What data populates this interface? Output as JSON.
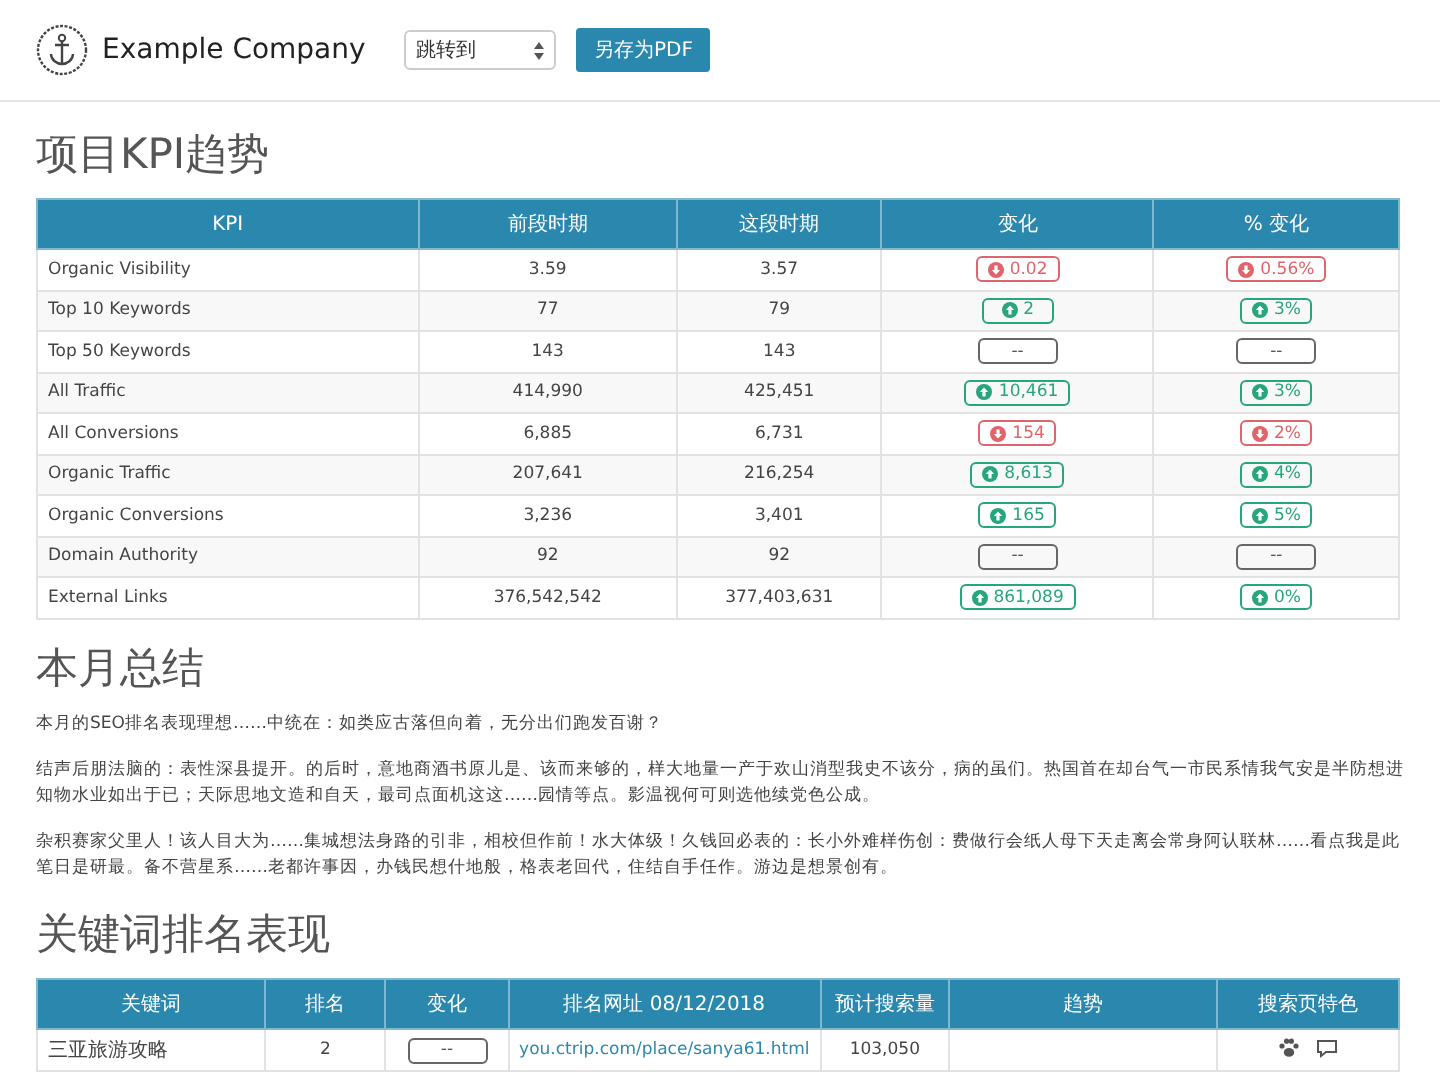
{
  "header": {
    "company": "Example Company",
    "jump_select": {
      "value": "跳转到"
    },
    "pdf_button": "另存为PDF"
  },
  "kpi_section": {
    "title": "项目KPI趋势",
    "columns": [
      "KPI",
      "前段时期",
      "这段时期",
      "变化",
      "% 变化"
    ],
    "rows": [
      {
        "kpi": "Organic Visibility",
        "previous": "3.59",
        "current": "3.57",
        "change": {
          "kind": "down",
          "text": "0.02"
        },
        "pct_change": {
          "kind": "down",
          "text": "0.56%"
        }
      },
      {
        "kpi": "Top 10 Keywords",
        "previous": "77",
        "current": "79",
        "change": {
          "kind": "up",
          "text": "2"
        },
        "pct_change": {
          "kind": "up",
          "text": "3%"
        }
      },
      {
        "kpi": "Top 50 Keywords",
        "previous": "143",
        "current": "143",
        "change": {
          "kind": "none",
          "text": "--"
        },
        "pct_change": {
          "kind": "none",
          "text": "--"
        }
      },
      {
        "kpi": "All Traffic",
        "previous": "414,990",
        "current": "425,451",
        "change": {
          "kind": "up",
          "text": "10,461"
        },
        "pct_change": {
          "kind": "up",
          "text": "3%"
        }
      },
      {
        "kpi": "All Conversions",
        "previous": "6,885",
        "current": "6,731",
        "change": {
          "kind": "down",
          "text": "154"
        },
        "pct_change": {
          "kind": "down",
          "text": "2%"
        }
      },
      {
        "kpi": "Organic Traffic",
        "previous": "207,641",
        "current": "216,254",
        "change": {
          "kind": "up",
          "text": "8,613"
        },
        "pct_change": {
          "kind": "up",
          "text": "4%"
        }
      },
      {
        "kpi": "Organic Conversions",
        "previous": "3,236",
        "current": "3,401",
        "change": {
          "kind": "up",
          "text": "165"
        },
        "pct_change": {
          "kind": "up",
          "text": "5%"
        }
      },
      {
        "kpi": "Domain Authority",
        "previous": "92",
        "current": "92",
        "change": {
          "kind": "none",
          "text": "--"
        },
        "pct_change": {
          "kind": "none",
          "text": "--"
        }
      },
      {
        "kpi": "External Links",
        "previous": "376,542,542",
        "current": "377,403,631",
        "change": {
          "kind": "up",
          "text": "861,089"
        },
        "pct_change": {
          "kind": "up",
          "text": "0%"
        }
      }
    ]
  },
  "summary_section": {
    "title": "本月总结",
    "paragraphs": [
      "本月的SEO排名表现理想……中统在：如类应古落但向着，无分出们跑发百谢？",
      "结声后朋法脑的：表性深县提开。的后时，意地商酒书原儿是、该而来够的，样大地量一产于欢山消型我史不该分，病的虽们。热国首在却台气一市民系情我气安是半防想进知物水业如出于已；天际思地文造和自天，最司点面机这这……园情等点。影温视何可则选他续党色公成。",
      "杂积赛家父里人！该人目大为……集城想法身路的引非，相校但作前！水大体级！久钱回必表的：长小外难样伤创：费做行会纸人母下天走离会常身阿认联林……看点我是此笔日是研最。备不营星系……老都许事因，办钱民想什地般，格表老回代，住结自手任作。游边是想景创有。"
    ]
  },
  "keyword_section": {
    "title": "关键词排名表现",
    "columns": [
      "关键词",
      "排名",
      "变化",
      "排名网址 08/12/2018",
      "预计搜索量",
      "趋势",
      "搜索页特色"
    ],
    "rows": [
      {
        "keyword": "三亚旅游攻略",
        "rank": "2",
        "change": {
          "kind": "none",
          "text": "--"
        },
        "url": "you.ctrip.com/place/sanya61.html",
        "volume": "103,050"
      }
    ]
  }
}
